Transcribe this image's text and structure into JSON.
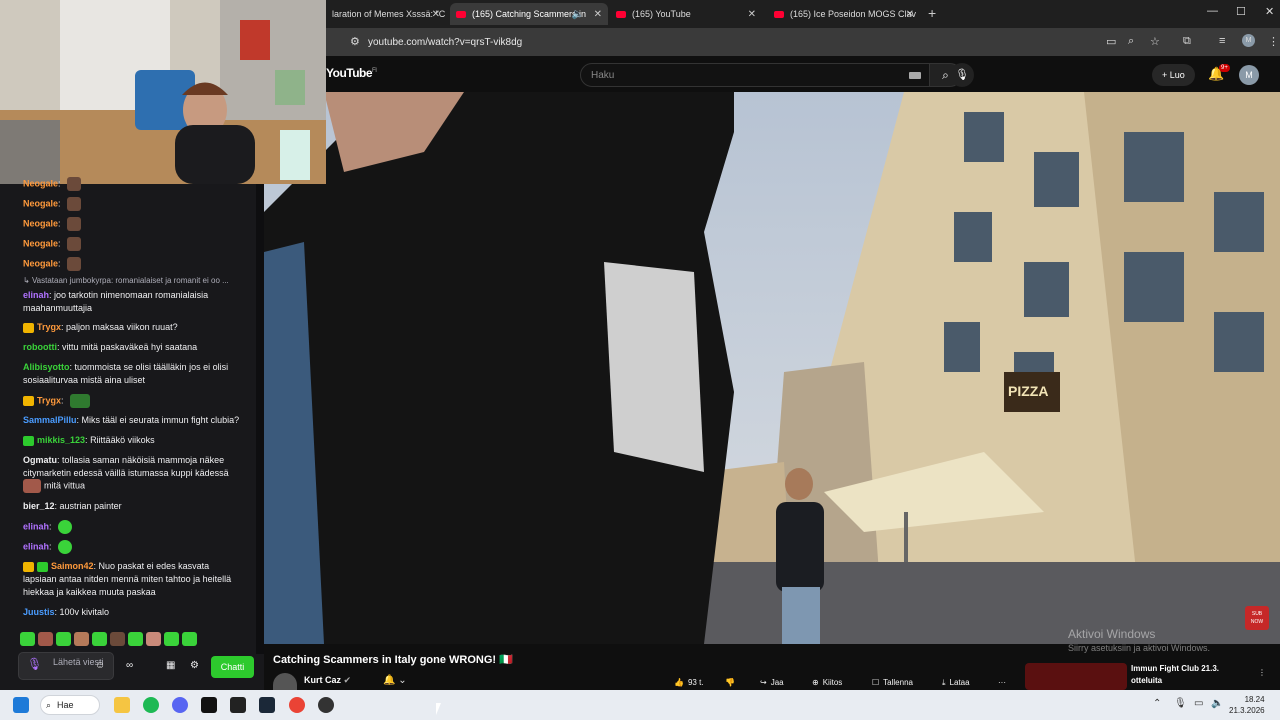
{
  "browser": {
    "tabs": [
      {
        "label": "laration of Memes Xsssä: \"C",
        "active": false
      },
      {
        "label": "(165) Catching Scammers in",
        "active": true
      },
      {
        "label": "(165) YouTube",
        "active": false
      },
      {
        "label": "(165) Ice Poseidon MOGS Clav",
        "active": false
      }
    ],
    "url": "youtube.com/watch?v=qrsT-vik8dg"
  },
  "youtube": {
    "logo": "YouTube",
    "logo_region": "FI",
    "search_placeholder": "Haku",
    "create_label": "Luo",
    "notif_count": "9+",
    "account_initial": "M",
    "video": {
      "title": "Catching Scammers in Italy gone WRONG! 🇮🇹",
      "channel": "Kurt Caz",
      "likes": "93 t.",
      "share": "Jaa",
      "thanks": "Kiitos",
      "save": "Tallenna",
      "download": "Lataa"
    },
    "up_next": {
      "title": "Immun Fight Club 21.3. otteluita"
    },
    "watermark_title": "Aktivoi Windows",
    "watermark_sub": "Siirry asetuksiin ja aktivoi Windows."
  },
  "chat": {
    "messages": [
      {
        "user": "Neogale",
        "text": "",
        "color": "#ff9a3c",
        "top": 0
      },
      {
        "user": "Neogale",
        "text": "",
        "color": "#ff9a3c"
      },
      {
        "user": "Neogale",
        "text": "",
        "color": "#ff9a3c"
      },
      {
        "user": "Neogale",
        "text": "",
        "color": "#ff9a3c"
      },
      {
        "user": "Neogale",
        "text": "",
        "color": "#ff9a3c"
      }
    ],
    "reply_prefix": "Vastataan jumbokyrpa: romanialaiset ja romanit ei oo ...",
    "m1_user": "elinah",
    "m1_text": "joo tarkotin nimenomaan romanialaisia maahanmuuttajia",
    "m2_user": "Trygx",
    "m2_text": "paljon maksaa viikon ruuat?",
    "m3_user": "robootti",
    "m3_text": "vittu mitä paskaväkeä hyi saatana",
    "m4_user": "Alibisyotto",
    "m4_text": "tuommoista se olisi täälläkin jos ei olisi sosiaaliturvaa mistä aina uliset",
    "m5_user": "Trygx",
    "m6_user": "SammalPillu",
    "m6_text": "Miks tääl ei seurata immun fight clubia?",
    "m7_user": "mikkis_123",
    "m7_text": "Riittääkö viikoks",
    "m8_user": "Ogmatu",
    "m8_text": "tollasia saman näköisiä mammoja näkee citymarketin edessä väillä istumassa kuppi kädessä",
    "m8_tail": "mitä vittua",
    "m9_user": "bier_12",
    "m9_text": "austrian painter",
    "m10_user": "elinah",
    "m11_user": "elinah",
    "m12_user": "Saimon42",
    "m12_text": "Nuo paskat ei edes kasvata lapsiaan antaa nitden mennä miten tahtoo ja heitellä hiekkaa ja kaikkea muuta paskaa",
    "m13_user": "Juustis",
    "m13_text": "100v kivitalo",
    "input_placeholder": "Lähetä viesti",
    "chat_button": "Chatti"
  },
  "taskbar": {
    "search_label": "Hae",
    "time": "18.24",
    "date": "21.3.2026"
  }
}
